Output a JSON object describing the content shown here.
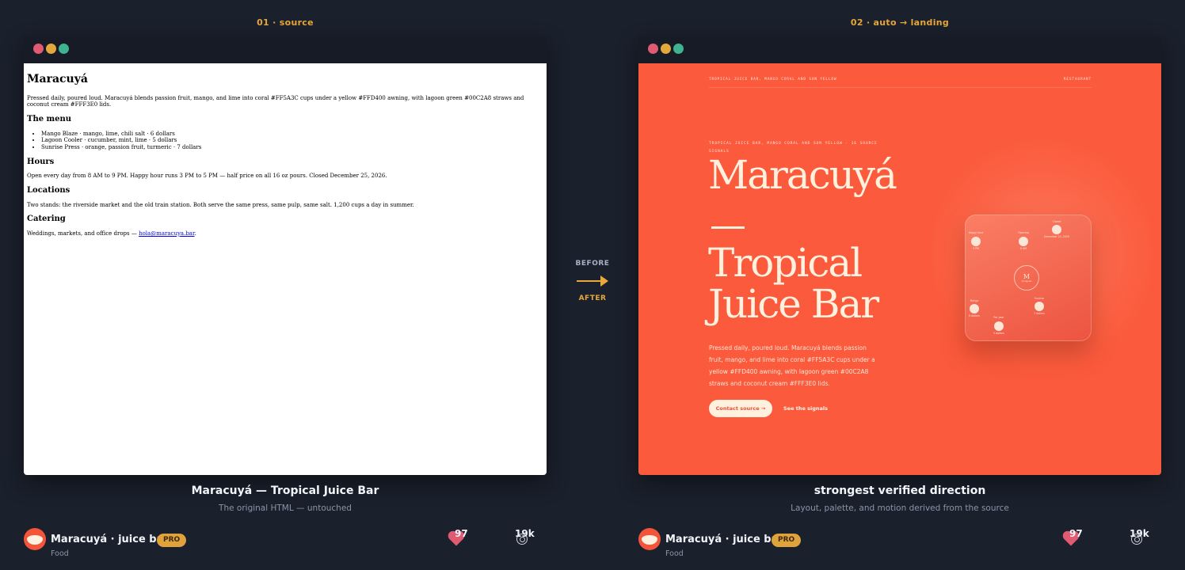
{
  "panels": {
    "left_label": "01 · source",
    "right_label": "02 · auto → landing"
  },
  "source_page": {
    "title": "Maracuyá",
    "intro": "Pressed daily, poured loud. Maracuyá blends passion fruit, mango, and lime into coral #FF5A3C cups under a yellow #FFD400 awning, with lagoon green #00C2A8 straws and coconut cream #FFF3E0 lids.",
    "menu_heading": "The menu",
    "menu_items": [
      "Mango Blaze · mango, lime, chili salt · 6 dollars",
      "Lagoon Cooler · cucumber, mint, lime · 5 dollars",
      "Sunrise Press · orange, passion fruit, turmeric · 7 dollars"
    ],
    "hours_heading": "Hours",
    "hours_text": "Open every day from 8 AM to 9 PM. Happy hour runs 3 PM to 5 PM — half price on all 16 oz pours. Closed December 25, 2026.",
    "locations_heading": "Locations",
    "locations_text": "Two stands: the riverside market and the old train station. Both serve the same press, same pulp, same salt. 1,200 cups a day in summer.",
    "catering_heading": "Catering",
    "catering_text": "Weddings, markets, and office drops — ",
    "catering_email": "hola@maracuya.bar",
    "catering_end": "."
  },
  "landing_page": {
    "nav_left": "Tropical juice bar, mango coral and sun yellow",
    "nav_right": "Restaurant",
    "eyebrow": "Tropical juice bar, mango coral and sun yellow · 16 source signals",
    "title": "Maracuyá",
    "subtitle_line1": "Tropical",
    "subtitle_line2": "Juice Bar",
    "description": "Pressed daily, poured loud. Maracuyá blends passion fruit, mango, and lime into coral #FF5A3C cups under a yellow #FFD400 awning, with lagoon green #00C2A8 straws and coconut cream #FFF3E0 lids.",
    "cta_primary": "Contact source →",
    "cta_secondary": "See the signals",
    "card": {
      "center_letter": "M",
      "center_caption": "16 signals",
      "nodes": [
        {
          "label": "Happy hour",
          "value": "3 PM"
        },
        {
          "label": "Opening",
          "value": "8 AM"
        },
        {
          "label": "Closed",
          "value": "December 25, 2026"
        },
        {
          "label": "Mango",
          "value": "6 dollars"
        },
        {
          "label": "Sunrise",
          "value": "7 dollars"
        },
        {
          "label": "Per year",
          "value": "5 dollars"
        }
      ]
    }
  },
  "transition": {
    "before": "BEFORE",
    "after": "AFTER"
  },
  "captions": {
    "left_title": "Maracuyá — Tropical Juice Bar",
    "left_sub": "The original HTML — untouched",
    "right_title": "strongest verified direction",
    "right_sub": "Layout, palette, and motion derived from the source"
  },
  "footer": {
    "shot_name": "Maracuyá · juice bar",
    "badge": "PRO",
    "category": "Food",
    "likes": "97",
    "views": "19k"
  },
  "colors": {
    "background": "#1a202c",
    "accent": "#e8a83a",
    "coral": "#fb5a3c",
    "cream": "#fff1de"
  }
}
